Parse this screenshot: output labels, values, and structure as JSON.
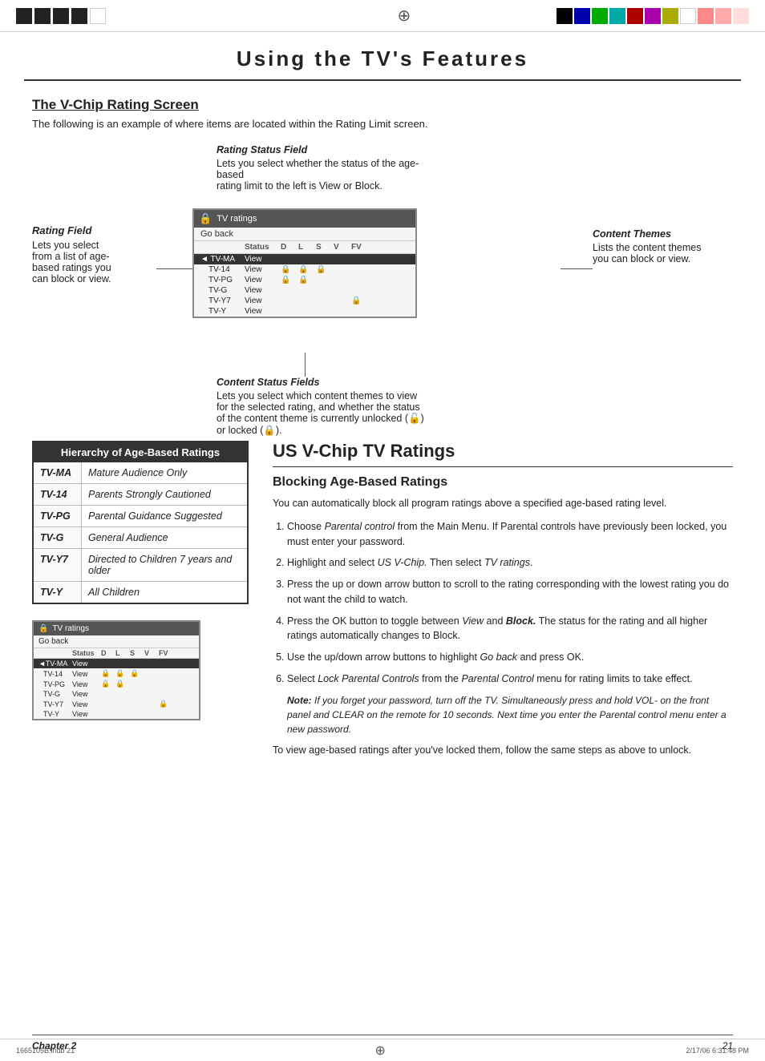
{
  "page": {
    "title": "Using the TV's Features",
    "chapter": "Chapter 2",
    "page_number": "21"
  },
  "top_bar": {
    "crosshair": "⊕",
    "color_squares": [
      "#000",
      "#000",
      "#000",
      "#000",
      "#00a",
      "#0a0",
      "#0aa",
      "#a00",
      "#a0a",
      "#aa0",
      "#fff",
      "#f88",
      "#faa",
      "#fdd"
    ]
  },
  "section": {
    "title": "The V-Chip Rating Screen",
    "intro": "The following is an example of where items are located within the Rating Limit screen."
  },
  "diagram": {
    "rating_status_field": {
      "label": "Rating Status Field",
      "desc1": "Lets you select whether the status of the age-based",
      "desc2": "rating limit to the left is View or Block."
    },
    "rating_field": {
      "label": "Rating Field",
      "desc1": "Lets you select",
      "desc2": "from a list of age-",
      "desc3": "based ratings you",
      "desc4": "can block or view."
    },
    "content_themes": {
      "label": "Content Themes",
      "desc1": "Lists the content themes",
      "desc2": "you can block or view."
    },
    "content_status_fields": {
      "label": "Content Status Fields",
      "desc1": "Lets you select which content themes to view for",
      "desc2": "the selected rating, and whether the status of",
      "desc3": "the content theme is currently unlocked (",
      "desc4": ") or",
      "desc5": "locked (",
      "desc6": ")."
    },
    "tv_ratings_box": {
      "header": "TV ratings",
      "go_back": "Go back",
      "cols": [
        "Status",
        "D",
        "L",
        "S",
        "V",
        "FV"
      ],
      "rows": [
        {
          "code": "TV-MA",
          "status": "View",
          "d": "",
          "l": "",
          "s": "",
          "v": "",
          "fv": "",
          "selected": true
        },
        {
          "code": "TV-14",
          "status": "View",
          "d": "🔒",
          "l": "🔒",
          "s": "🔒",
          "v": "",
          "fv": ""
        },
        {
          "code": "TV-PG",
          "status": "View",
          "d": "🔒",
          "l": "🔒",
          "s": "",
          "v": "",
          "fv": ""
        },
        {
          "code": "TV-G",
          "status": "View",
          "d": "",
          "l": "",
          "s": "",
          "v": "",
          "fv": ""
        },
        {
          "code": "TV-Y7",
          "status": "View",
          "d": "",
          "l": "",
          "s": "",
          "v": "",
          "fv": "🔒"
        },
        {
          "code": "TV-Y",
          "status": "View",
          "d": "",
          "l": "",
          "s": "",
          "v": "",
          "fv": ""
        }
      ]
    }
  },
  "hierarchy_table": {
    "title": "Hierarchy of Age-Based Ratings",
    "rows": [
      {
        "code": "TV-MA",
        "desc": "Mature Audience Only"
      },
      {
        "code": "TV-14",
        "desc": "Parents Strongly Cautioned"
      },
      {
        "code": "TV-PG",
        "desc": "Parental Guidance Suggested"
      },
      {
        "code": "TV-G",
        "desc": "General Audience"
      },
      {
        "code": "TV-Y7",
        "desc": "Directed to Children 7 years and older"
      },
      {
        "code": "TV-Y",
        "desc": "All Children"
      }
    ]
  },
  "us_vchip": {
    "title": "US V-Chip TV Ratings",
    "blocking_title": "Blocking Age-Based Ratings",
    "intro_text": "You can automatically block all program ratings above a specified age-based rating level.",
    "steps": [
      {
        "num": "1.",
        "text_before": "Choose ",
        "italic1": "Parental control",
        "text_mid": " from the Main Menu. If Parental controls have previously been locked, you must enter your password."
      },
      {
        "num": "2.",
        "text_before": "Highlight and select ",
        "italic1": "US V-Chip.",
        "text_mid": " Then select ",
        "italic2": "TV ratings",
        "text_end": "."
      },
      {
        "num": "3.",
        "text": "Press the up or down arrow button to scroll to the rating corresponding with the lowest rating you do not want the child to watch."
      },
      {
        "num": "4.",
        "text_before": "Press the OK button to toggle between ",
        "italic1": "View",
        "text_mid": " and ",
        "italic2": "Block.",
        "text_end": " The status for the rating and all higher ratings automatically changes to Block."
      },
      {
        "num": "5.",
        "text_before": "Use the up/down arrow buttons to highlight ",
        "italic1": "Go back",
        "text_end": " and press OK."
      },
      {
        "num": "6.",
        "text_before": "Select ",
        "italic1": "Lock Parental Controls",
        "text_mid": " from the ",
        "italic2": "Parental Control",
        "text_end": " menu for rating limits to take effect."
      }
    ],
    "note_label": "Note:",
    "note_text": " If you forget your password, turn off the TV. Simultaneously press and hold VOL- on the front panel and CLEAR on the remote for 10 seconds. Next time you enter the Parental control menu enter a new password.",
    "final_text": "To view age-based ratings after you've locked them, follow the same steps as above to unlock."
  },
  "footer": {
    "chapter": "Chapter 2",
    "page_number": "21"
  },
  "bottom_bar": {
    "left_text": "1665105B.indb   21",
    "crosshair": "⊕",
    "right_text": "2/17/06   6:31:48 PM"
  }
}
